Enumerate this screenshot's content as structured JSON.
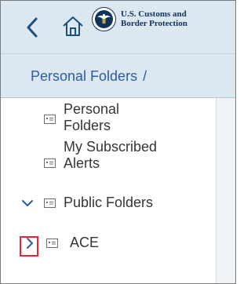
{
  "header": {
    "brand_line1": "U.S. Customs and",
    "brand_line2": "Border Protection",
    "colors": {
      "background": "#dbe7f1",
      "brand_text": "#10335c",
      "icon": "#1f4f80"
    }
  },
  "breadcrumb": {
    "current": "Personal Folders",
    "separator": "/"
  },
  "tree": {
    "items": [
      {
        "label_line1": "Personal",
        "label_line2": "Folders",
        "icon": "folder-icon"
      },
      {
        "label_line1": "My Subscribed",
        "label_line2": "Alerts",
        "icon": "folder-icon"
      },
      {
        "label": "Public Folders",
        "icon": "folder-icon",
        "state": "expanded"
      },
      {
        "label": "ACE",
        "icon": "folder-icon",
        "state": "collapsed"
      }
    ]
  },
  "highlight": {
    "color": "#e32535",
    "target": "ACE expand chevron"
  }
}
